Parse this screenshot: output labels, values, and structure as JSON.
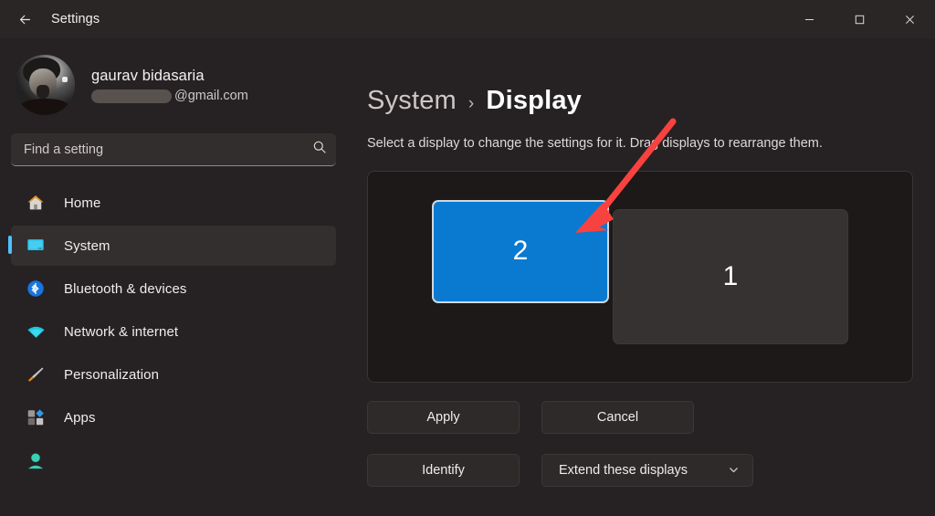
{
  "window": {
    "title": "Settings",
    "back_icon": "back-arrow-icon",
    "controls": {
      "minimize": "minimize-icon",
      "maximize": "maximize-icon",
      "close": "close-icon"
    }
  },
  "account": {
    "name": "gaurav bidasaria",
    "email_suffix": "@gmail.com",
    "email_redacted": true,
    "avatar": "user-avatar-photo"
  },
  "search": {
    "placeholder": "Find a setting",
    "value": "",
    "icon": "search-icon"
  },
  "sidebar": {
    "items": [
      {
        "label": "Home",
        "icon": "home-icon",
        "selected": false
      },
      {
        "label": "System",
        "icon": "monitor-icon",
        "selected": true
      },
      {
        "label": "Bluetooth & devices",
        "icon": "bluetooth-icon",
        "selected": false
      },
      {
        "label": "Network & internet",
        "icon": "wifi-icon",
        "selected": false
      },
      {
        "label": "Personalization",
        "icon": "paintbrush-icon",
        "selected": false
      },
      {
        "label": "Apps",
        "icon": "apps-icon",
        "selected": false
      },
      {
        "label": "",
        "icon": "accounts-icon",
        "selected": false
      }
    ]
  },
  "main": {
    "breadcrumb": {
      "parent": "System",
      "separator": "›",
      "current": "Display"
    },
    "subtitle": "Select a display to change the settings for it. Drag displays to rearrange them.",
    "displays": [
      {
        "number": "2",
        "selected": true
      },
      {
        "number": "1",
        "selected": false
      }
    ],
    "buttons": {
      "apply": "Apply",
      "cancel": "Cancel",
      "identify": "Identify"
    },
    "dropdown": {
      "value": "Extend these displays",
      "icon": "chevron-down-icon"
    }
  },
  "annotation": {
    "arrow_color": "#f8423f",
    "type": "arrow-pointing-to-display-2"
  },
  "colors": {
    "accent_blue": "#0a7ad1",
    "nav_accent": "#4cc2ff",
    "window_bg": "#262223",
    "panel_bg": "#1c1918"
  }
}
